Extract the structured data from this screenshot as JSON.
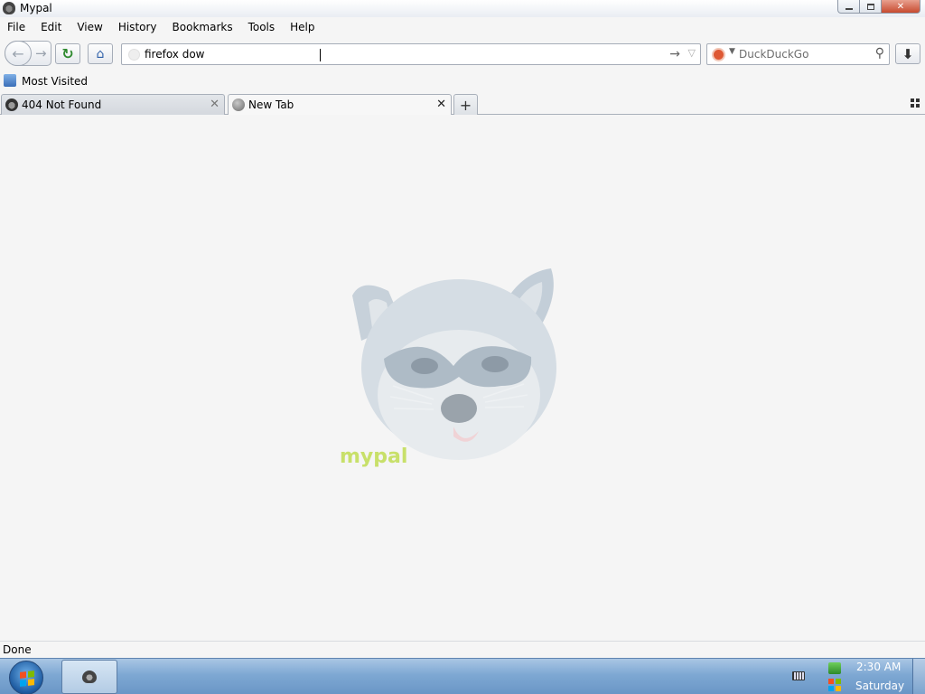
{
  "window": {
    "title": "Mypal"
  },
  "menu": {
    "items": [
      "File",
      "Edit",
      "View",
      "History",
      "Bookmarks",
      "Tools",
      "Help"
    ]
  },
  "navbar": {
    "url_value": "firefox dow",
    "search_placeholder": "DuckDuckGo"
  },
  "bookmarks": {
    "most_visited": "Most Visited"
  },
  "tabs": [
    {
      "title": "404 Not Found",
      "active": false
    },
    {
      "title": "New Tab",
      "active": true
    }
  ],
  "content": {
    "mascot_wordmark": "mypal"
  },
  "status": {
    "text": "Done"
  },
  "taskbar": {
    "clock_time": "2:30 AM",
    "clock_day": "Saturday"
  },
  "colors": {
    "page_bg": "#f5f5f5",
    "taskbar": "#7ea8d3",
    "close_button": "#c74a2f",
    "search_engine": "#de5833",
    "wordmark": "#c8e06a"
  }
}
